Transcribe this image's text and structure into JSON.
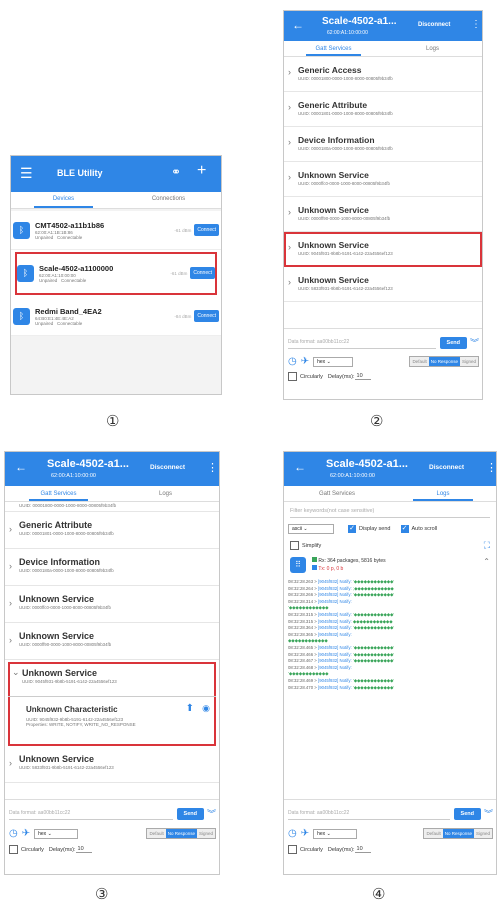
{
  "colors": {
    "accent": "#2f86e6",
    "highlight": "#d9343a",
    "green": "#3aa55a"
  },
  "captions": [
    "①",
    "②",
    "③",
    "④"
  ],
  "p1": {
    "title": "BLE Utility",
    "tabs": [
      "Devices",
      "Connections"
    ],
    "devices": [
      {
        "name": "CMT4502-a11b1b86",
        "mac": "62:00:A1:1B:1B:86",
        "status": "Unpaired",
        "conn": "Connectable",
        "rssi": "-61 dBm",
        "btn": "Connect"
      },
      {
        "name": "Scale-4502-a1100000",
        "mac": "62:00:A1:10:00:00",
        "status": "Unpaired",
        "conn": "Connectable",
        "rssi": "-61 dBm",
        "btn": "Connect"
      },
      {
        "name": "Redmi Band_4EA2",
        "mac": "64:B0:E1:4E:4E:A2",
        "status": "Unpaired",
        "conn": "Connectable",
        "rssi": "-84 dBm",
        "btn": "Connect"
      }
    ]
  },
  "common": {
    "title": "Scale-4502-a1...",
    "mac": "62:00:A1:10:00:00",
    "disconnect": "Disconnect",
    "tabs": [
      "Gatt Services",
      "Logs"
    ],
    "input_placeholder": "Data format: aa00bb11cc22",
    "send": "Send",
    "select": "hex",
    "seg": [
      "Default",
      "No Response",
      "Signed"
    ],
    "circularly": "Circularly",
    "delay_label": "Delay(ms):",
    "delay_value": "10"
  },
  "p2": {
    "services": [
      {
        "name": "Generic Access",
        "uuid": "UUID: 00001800-0000-1000-8000-00805f9b34fb"
      },
      {
        "name": "Generic Attribute",
        "uuid": "UUID: 00001801-0000-1000-8000-00805f9b34fb"
      },
      {
        "name": "Device Information",
        "uuid": "UUID: 0000180a-0000-1000-8000-00805f9b34fb"
      },
      {
        "name": "Unknown Service",
        "uuid": "UUID: 0000ffc0-0000-1000-8000-00805f9b34fb"
      },
      {
        "name": "Unknown Service",
        "uuid": "UUID: 0000ff90-0000-1000-8000-00805f9b34fb"
      },
      {
        "name": "Unknown Service",
        "uuid": "UUID: 9045f931-9b8b-5191-6142-22a4556ef123"
      },
      {
        "name": "Unknown Service",
        "uuid": "UUID: 5833f931-9b8b-5191-6142-22a4556ef123"
      }
    ]
  },
  "p3": {
    "top_uuid": "UUID: 00001800-0000-1000-8000-00805f9b34fb",
    "services": [
      {
        "name": "Generic Attribute",
        "uuid": "UUID: 00001801-0000-1000-8000-00805f9b34fb"
      },
      {
        "name": "Device Information",
        "uuid": "UUID: 0000180a-0000-1000-8000-00805f9b34fb"
      },
      {
        "name": "Unknown Service",
        "uuid": "UUID: 0000ffc0-0000-1000-8000-00805f9b34fb"
      },
      {
        "name": "Unknown Service",
        "uuid": "UUID: 0000ff90-0000-1000-8000-00805f9b34fb"
      }
    ],
    "expanded": {
      "name": "Unknown Service",
      "uuid": "UUID: 9045f931-9b8b-5191-6142-22a4556ef123"
    },
    "char": {
      "name": "Unknown Characteristic",
      "uuid": "UUID: 9045f932-9b8b-5191-6142-22a4556ef123",
      "props": "Properties: WRITE, NOTIFY, WRITE_NO_RESPONSE"
    },
    "last": {
      "name": "Unknown Service",
      "uuid": "UUID: 5833f931-9b8b-5191-6142-22a4556ef123"
    }
  },
  "p4": {
    "filter": "Filter keywords(not case sensitive)",
    "sel": "ascii",
    "display_send": "Display send",
    "auto_scroll": "Auto scroll",
    "simplify": "Simplify",
    "rx": "Rx: 364 packages, 5816 bytes",
    "tx": "Tx: 0 p, 0 b",
    "lines": [
      {
        "t": "08:32:28.263 >",
        "tag": "[9045f932] Notify:",
        "v": " '◆◆◆◆◆◆◆◆◆◆◆◆'"
      },
      {
        "t": "08:32:28.264 >",
        "tag": "[9045f932] Notify:",
        "v": " ;◆◆◆◆◆◆◆◆◆◆◆◆"
      },
      {
        "t": "08:32:28.266 >",
        "tag": "[9045f932] Notify:",
        "v": " '◆◆◆◆◆◆◆◆◆◆◆◆'"
      },
      {
        "t": "08:32:28.314 >",
        "tag": "[9045f932] Notify:",
        "v": ""
      },
      {
        "t": "",
        "tag": "",
        "v": "  '◆◆◆◆◆◆◆◆◆◆◆◆"
      },
      {
        "t": "08:32:28.315 >",
        "tag": "[9045f932] Notify:",
        "v": " '◆◆◆◆◆◆◆◆◆◆◆◆'"
      },
      {
        "t": "08:32:28.315 >",
        "tag": "[9045f932] Notify:",
        "v": " ◆◆◆◆◆◆◆◆◆◆◆◆"
      },
      {
        "t": "08:32:28.364 >",
        "tag": "[9045f932] Notify:",
        "v": " '◆◆◆◆◆◆◆◆◆◆◆◆'"
      },
      {
        "t": "08:32:28.365 >",
        "tag": "[9045f932] Notify:",
        "v": ""
      },
      {
        "t": "",
        "tag": "",
        "v": "  ◆◆◆◆◆◆◆◆◆◆◆◆"
      },
      {
        "t": "08:32:28.465 >",
        "tag": "[9045f932] Notify:",
        "v": " '◆◆◆◆◆◆◆◆◆◆◆◆'"
      },
      {
        "t": "08:32:28.466 >",
        "tag": "[9045f932] Notify:",
        "v": " '◆◆◆◆◆◆◆◆◆◆◆◆'"
      },
      {
        "t": "08:32:28.467 >",
        "tag": "[9045f932] Notify:",
        "v": " '◆◆◆◆◆◆◆◆◆◆◆◆'"
      },
      {
        "t": "08:32:28.468 >",
        "tag": "[9045f932] Notify:",
        "v": ""
      },
      {
        "t": "",
        "tag": "",
        "v": "  '◆◆◆◆◆◆◆◆◆◆◆◆"
      },
      {
        "t": "08:32:28.469 >",
        "tag": "[9045f932] Notify:",
        "v": " '◆◆◆◆◆◆◆◆◆◆◆◆'"
      },
      {
        "t": "08:32:28.470 >",
        "tag": "[9045f932] Notify:",
        "v": " '◆◆◆◆◆◆◆◆◆◆◆◆'"
      }
    ]
  }
}
